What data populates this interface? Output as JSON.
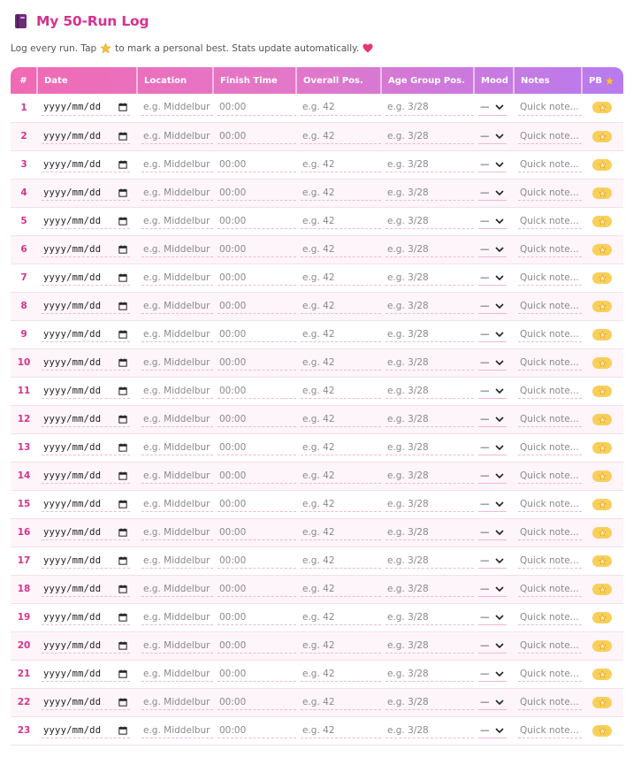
{
  "header": {
    "title": "My 50-Run Log",
    "subtitle_before": "Log every run. Tap",
    "subtitle_after": "to mark a personal best. Stats update automatically."
  },
  "colors": {
    "accent": "#d6338f",
    "header_start": "#f06ab4",
    "header_end": "#b77bf0",
    "star": "#f8cf5a"
  },
  "columns": {
    "num": "#",
    "date": "Date",
    "location": "Location",
    "finish": "Finish Time",
    "overall": "Overall Pos.",
    "age": "Age Group Pos.",
    "mood": "Mood",
    "notes": "Notes",
    "pb": "PB"
  },
  "row_template": {
    "date_value": "yyyy/mm/dd",
    "location_placeholder": "e.g. Middelbur",
    "finish_placeholder": "00:00",
    "overall_placeholder": "e.g. 42",
    "age_placeholder": "e.g. 3/28",
    "mood_value": "—",
    "notes_placeholder": "Quick note..."
  },
  "rows": [
    "1",
    "2",
    "3",
    "4",
    "5",
    "6",
    "7",
    "8",
    "9",
    "10",
    "11",
    "12",
    "13",
    "14",
    "15",
    "16",
    "17",
    "18",
    "19",
    "20",
    "21",
    "22",
    "23"
  ],
  "icons": {
    "title": "book-icon",
    "star": "star-icon",
    "heart": "heart-icon",
    "date": "calendar-icon",
    "mood": "chevron-down-icon"
  }
}
